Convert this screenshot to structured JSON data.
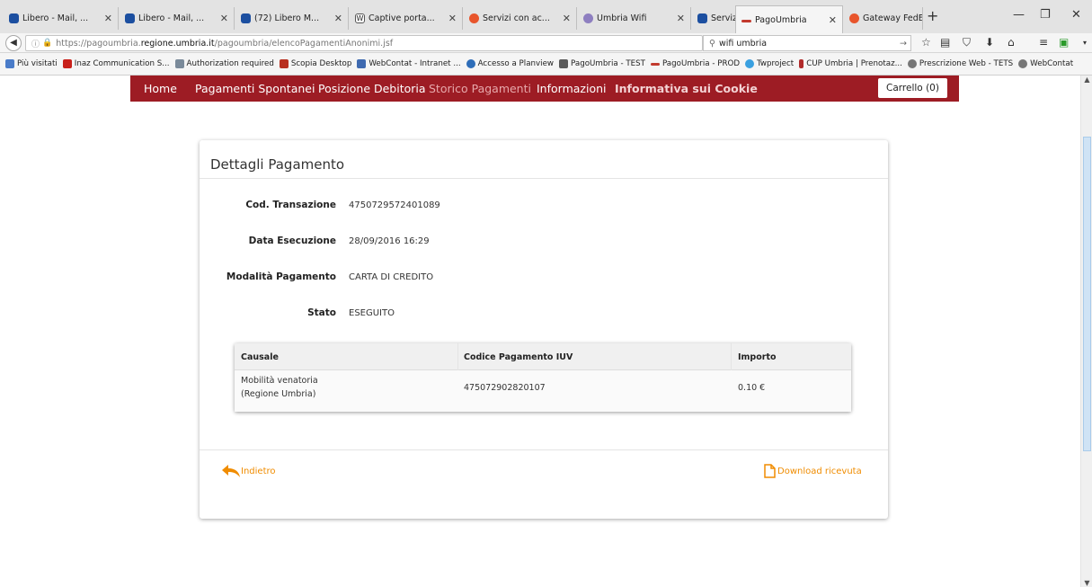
{
  "browser": {
    "tabs": [
      {
        "label": "Libero - Mail, ...",
        "color": "#1c4fa0"
      },
      {
        "label": "Libero - Mail, ...",
        "color": "#1c4fa0"
      },
      {
        "label": "(72) Libero M...",
        "color": "#1c4fa0"
      },
      {
        "label": "Captive porta...",
        "color": "#555555"
      },
      {
        "label": "Servizi con ac...",
        "color": "#e8552c"
      },
      {
        "label": "Umbria Wifi",
        "color": "#8e7fc0"
      },
      {
        "label": "Servizi di inte...",
        "color": "#1c4fa0"
      },
      {
        "label": "PagoUmbria",
        "color": "#c23a2e"
      },
      {
        "label": "Gateway FedE...",
        "color": "#e8552c"
      }
    ],
    "url": {
      "prefix": "https://pagoumbria.",
      "domain": "regione.umbria.it",
      "path": "/pagoumbria/elencoPagamentiAnonimi.jsf"
    },
    "search_value": "wifi umbria",
    "bookmarks": [
      {
        "label": "Più visitati",
        "color": "#4a7cc9"
      },
      {
        "label": "Inaz Communication S...",
        "color": "#c8201a"
      },
      {
        "label": "Authorization required",
        "color": "#7a8a9a"
      },
      {
        "label": "Scopia Desktop",
        "color": "#b83020"
      },
      {
        "label": "WebContat - Intranet ...",
        "color": "#3f6ab0"
      },
      {
        "label": "Accesso a Planview",
        "color": "#2e6db8"
      },
      {
        "label": "PagoUmbria - TEST",
        "color": "#5a5a5a"
      },
      {
        "label": "PagoUmbria - PROD",
        "color": "#c23a2e"
      },
      {
        "label": "Twproject",
        "color": "#3aa0e0"
      },
      {
        "label": "CUP Umbria | Prenotaz...",
        "color": "#b02a2a"
      },
      {
        "label": "Prescrizione Web - TETS",
        "color": "#777777"
      },
      {
        "label": "WebContat",
        "color": "#777777"
      }
    ]
  },
  "site_nav": {
    "home": "Home",
    "pagamenti_spontanei": "Pagamenti Spontanei",
    "posizione_debitoria": "Posizione Debitoria",
    "storico_pagamenti": "Storico Pagamenti",
    "informazioni": "Informazioni",
    "informativa_cookie": "Informativa sui Cookie",
    "cart": "Carrello (0)",
    "brand_color": "#9d1c24"
  },
  "details": {
    "title": "Dettagli Pagamento",
    "fields": [
      {
        "label": "Cod. Transazione",
        "value": "4750729572401089"
      },
      {
        "label": "Data Esecuzione",
        "value": "28/09/2016 16:29"
      },
      {
        "label": "Modalità Pagamento",
        "value": "CARTA DI CREDITO"
      },
      {
        "label": "Stato",
        "value": "ESEGUITO"
      }
    ],
    "table": {
      "headers": [
        "Causale",
        "Codice Pagamento IUV",
        "Importo"
      ],
      "rows": [
        {
          "causale_line1": "Mobilità venatoria",
          "causale_line2": "(Regione Umbria)",
          "iuv": "475072902820107",
          "importo": "0.10 €"
        }
      ]
    },
    "back_label": "Indietro",
    "download_label": "Download ricevuta",
    "link_color": "#f08c00"
  }
}
